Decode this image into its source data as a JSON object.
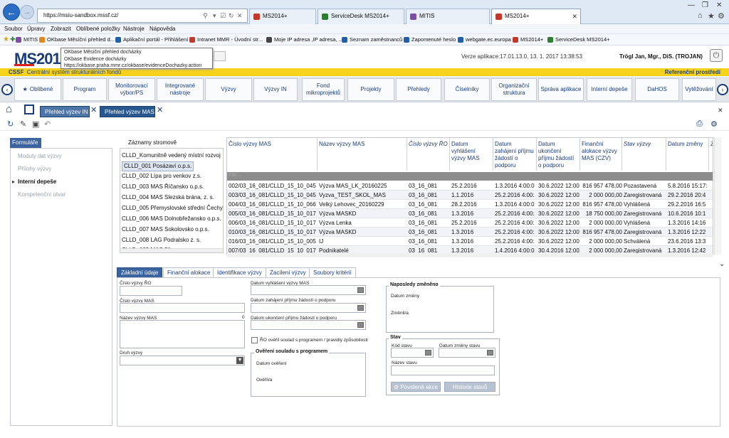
{
  "browser": {
    "url": "https://msiu-sandbox.mssf.cz/",
    "tabs": [
      {
        "label": "MS2014+",
        "color": "#c0392b"
      },
      {
        "label": "ServiceDesk MS2014+",
        "color": "#2e7d32"
      },
      {
        "label": "MITIS",
        "color": "#7b4fa0"
      },
      {
        "label": "MS2014+",
        "color": "#c0392b"
      }
    ],
    "menu": [
      "Soubor",
      "Úpravy",
      "Zobrazit",
      "Oblíbené položky",
      "Nástroje",
      "Nápověda"
    ],
    "favorites": [
      {
        "label": "MITIS",
        "color": "#7b4fa0"
      },
      {
        "label": "OKbase Měsíční přehled d...",
        "color": "#e08a1e"
      },
      {
        "label": "Aplikační portál - Přihlášení",
        "color": "#1f5fa8"
      },
      {
        "label": "Intranet MMR - Úvodní str...",
        "color": "#c0392b"
      },
      {
        "label": "Moje IP adresa ,IP adresa, ...",
        "color": "#444444"
      },
      {
        "label": "Seznam zaměstnanců",
        "color": "#1f5fa8"
      },
      {
        "label": "Zapomenuté heslo",
        "color": "#1f5fa8"
      },
      {
        "label": "webgate.ec.europa",
        "color": "#1f5fa8"
      },
      {
        "label": "MS2014+",
        "color": "#c0392b"
      },
      {
        "label": "ServiceDesk MS2014+",
        "color": "#2e7d32"
      }
    ],
    "tooltip": [
      "OKbase Měsíční přehled docházky",
      "OKbase Evidence docházky",
      "https://okbase.praha.mmr.cz/okbase/evidenceDochazky.action"
    ]
  },
  "app": {
    "logo": "MS2014",
    "logo_plus": "+",
    "version": "Verze aplikace:17.01.13.0, 13. 1. 2017 13:38:53",
    "user": "Trögl Jan, Mgr., DiS. (TROJAN)",
    "banner_code": "CSSF",
    "banner_text": "Centrální systém strukturálních fondů",
    "environment": "Referenční prostředí"
  },
  "modules": [
    "Oblíbené",
    "Program",
    "Monitorovací výbor/PS",
    "Integrované nástroje",
    "Výzvy",
    "Výzvy IN",
    "Fond mikroprojektů",
    "Projekty",
    "Přehledy",
    "Číselníky",
    "Organizační struktura",
    "Správa aplikace",
    "Interní depeše",
    "DaHOS",
    "Vytěžování"
  ],
  "page_tabs": [
    "Přehled výzev IN",
    "Přehled výzev MAS"
  ],
  "left": {
    "header": "Formuláře",
    "items": [
      "Moduly dat výzvy",
      "Přílohy výzvy",
      "Interní depeše",
      "Kompetenční útvar"
    ]
  },
  "tree": {
    "title": "Záznamy stromově",
    "nodes": [
      "CLLD_Komunitně vedený místní rozvoj",
      "CLLD_001 Posázaví o.p.s.",
      "CLLD_002 Lípa pro venkov z.s.",
      "CLLD_003 MAS Říčansko o.p.s.",
      "CLLD_004 MAS Slezská brána, z. s.",
      "CLLD_005 Přemyslovské střední Čechy",
      "CLLD_006 MAS Dolnobřežansko o.p.s.",
      "CLLD_007 MAS Sokolovsko o.p.s.",
      "CLLD_008 LAG Podralsko z. s.",
      "CLLD_009 MAS 21, o.p.s."
    ]
  },
  "grid": {
    "filter_placeholder": "Filtr ...",
    "columns": [
      "Číslo výzvy MAS",
      "Název výzvy MAS",
      "Číslo výzvy ŘO",
      "Datum vyhlášení výzvy MAS",
      "Datum zahájení příjmu žádostí o podporu",
      "Datum ukončení příjmu žádostí o podporu",
      "Finanční alokace výzvy MAS (CZV)",
      "Stav výzvy",
      "Datum změny",
      "Z"
    ],
    "rows": [
      [
        "002/03_16_081/CLLD_15_10_045",
        "Výzva MAS_LK_20160225",
        "03_16_081",
        "25.2.2016",
        "1.3.2016 4:00:0",
        "30.6.2022 12:00",
        "816 957 478,00",
        "Pozastavená",
        "5.8.2016 15:17:"
      ],
      [
        "003/03_16_081/CLLD_15_10_045",
        "Vyzva_TEST_SKOL_MAS",
        "03_16_081",
        "1.1.2016",
        "25.2.2016 4:00:",
        "30.6.2022 12:00",
        "2 000 000,00",
        "Zaregistrovaná",
        "29.2.2016 20:4"
      ],
      [
        "004/03_16_081/CLLD_15_10_066",
        "Velký Lehovec_20160229",
        "03_16_081",
        "28.2.2016",
        "1.3.2016 4:00:0",
        "30.6.2022 12:00",
        "816 957 478,00",
        "Vyhlášená",
        "29.2.2016 16:5"
      ],
      [
        "005/03_16_081/CLLD_15_10_017",
        "Výzva MASKD",
        "03_16_081",
        "1.3.2016",
        "25.2.2016 4:00:",
        "30.6.2022 12:00",
        "18 750 000,00",
        "Zaregistrovaná",
        "10.6.2016 10:1"
      ],
      [
        "006/03_16_081/CLLD_15_10_017",
        "Výzva Lenka",
        "03_16_081",
        "25.2.2016",
        "25.2.2016 4:00:",
        "30.6.2022 12:00",
        "2 000 000,00",
        "Vyhlášená",
        "1.3.2016 14:16"
      ],
      [
        "010/03_16_081/CLLD_15_10_017",
        "Výzva MASKD",
        "03_16_081",
        "1.3.2016",
        "25.2.2016 4:00:",
        "30.6.2022 12:00",
        "816 957 478,00",
        "Zaregistrovaná",
        "1.3.2016 12:22"
      ],
      [
        "016/03_16_081/CLLD_15_10_005",
        "IJ",
        "03_16_081",
        "1.3.2016",
        "25.2.2016 4:00:",
        "30.6.2022 12:00",
        "2 000 000,00",
        "Schválená",
        "23.6.2016 13:3"
      ],
      [
        "007/03_16_081/CLLD_15_10_017",
        "Podnikatelé",
        "03_16_081",
        "1.3.2016",
        "1.4.2016 4:00:0",
        "30.4.2016 12:00",
        "2 000 000,00",
        "Zaregistrovaná",
        "1.3.2016 12:42"
      ]
    ]
  },
  "detail_tabs": [
    "Základní údaje",
    "Finanční alokace",
    "Identifikace výzvy",
    "Zacílení výzvy",
    "Soubory kritérií"
  ],
  "form": {
    "cislo_vyzvy_ro": "Číslo výzvy ŘO",
    "cislo_vyzvy_mas": "Číslo výzvy MAS",
    "nazev_vyzvy_mas": "Název výzvy MAS",
    "nazev_counter": "0",
    "druh_vyzvy": "Druh výzvy",
    "datum_vyhlaseni": "Datum vyhlášení výzvy MAS",
    "datum_zahajeni": "Datum zahájení příjmu žádostí o podporu",
    "datum_ukonceni": "Datum ukončení příjmu žádostí o podporu",
    "ro_overil": "ŘO ověřil soulad s programem / pravidly způsobilosti",
    "overeni_title": "Ověření souladu s programem",
    "datum_overeni": "Datum ověření",
    "overil": "Ověřil/a",
    "naposledy_title": "Naposledy změněno",
    "datum_zmeny": "Datum změny",
    "zmenil": "Změnil/a",
    "stav_title": "Stav",
    "kod_stavu": "Kód stavu",
    "datum_zmeny_stavu": "Datum změny stavu",
    "nazev_stavu": "Název stavu",
    "btn_povolene": "Povolené akce",
    "btn_historie": "Historie stavů"
  }
}
